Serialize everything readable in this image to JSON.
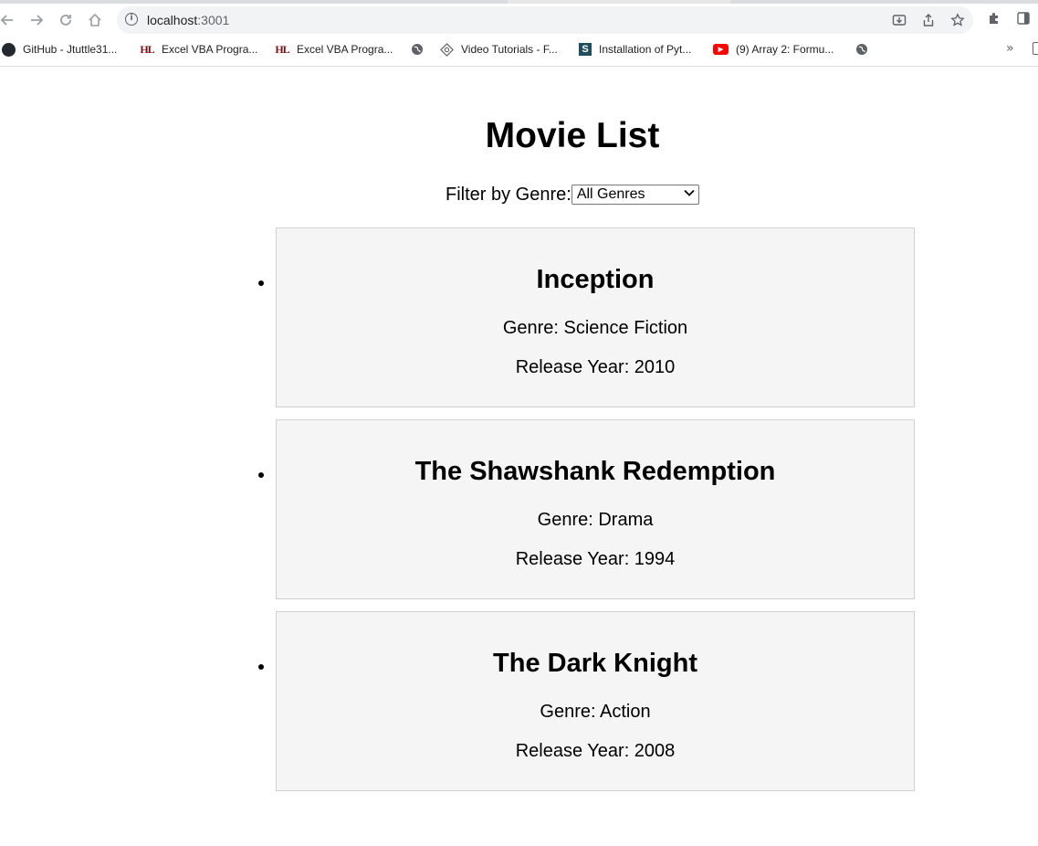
{
  "browser": {
    "url_host": "localhost",
    "url_port": ":3001",
    "bookmarks": [
      {
        "label": "GitHub - Jtuttle31...",
        "icon": "github-icon"
      },
      {
        "label": "Excel VBA Progra...",
        "icon": "hl-icon"
      },
      {
        "label": "Excel VBA Progra...",
        "icon": "hl-icon"
      },
      {
        "label": "",
        "icon": "globe-icon"
      },
      {
        "label": "Video Tutorials - F...",
        "icon": "video-tutorials-icon"
      },
      {
        "label": "Installation of Pyt...",
        "icon": "s-icon"
      },
      {
        "label": "(9) Array 2: Formu...",
        "icon": "youtube-icon"
      },
      {
        "label": "",
        "icon": "globe-icon"
      }
    ],
    "bookmarks_more": "»"
  },
  "app": {
    "title": "Movie List",
    "filter_label": "Filter by Genre:",
    "filter_selected": "All Genres"
  },
  "movies": [
    {
      "title": "Inception",
      "genre_label": "Genre: Science Fiction",
      "year_label": "Release Year: 2010"
    },
    {
      "title": "The Shawshank Redemption",
      "genre_label": "Genre: Drama",
      "year_label": "Release Year: 1994"
    },
    {
      "title": "The Dark Knight",
      "genre_label": "Genre: Action",
      "year_label": "Release Year: 2008"
    }
  ]
}
